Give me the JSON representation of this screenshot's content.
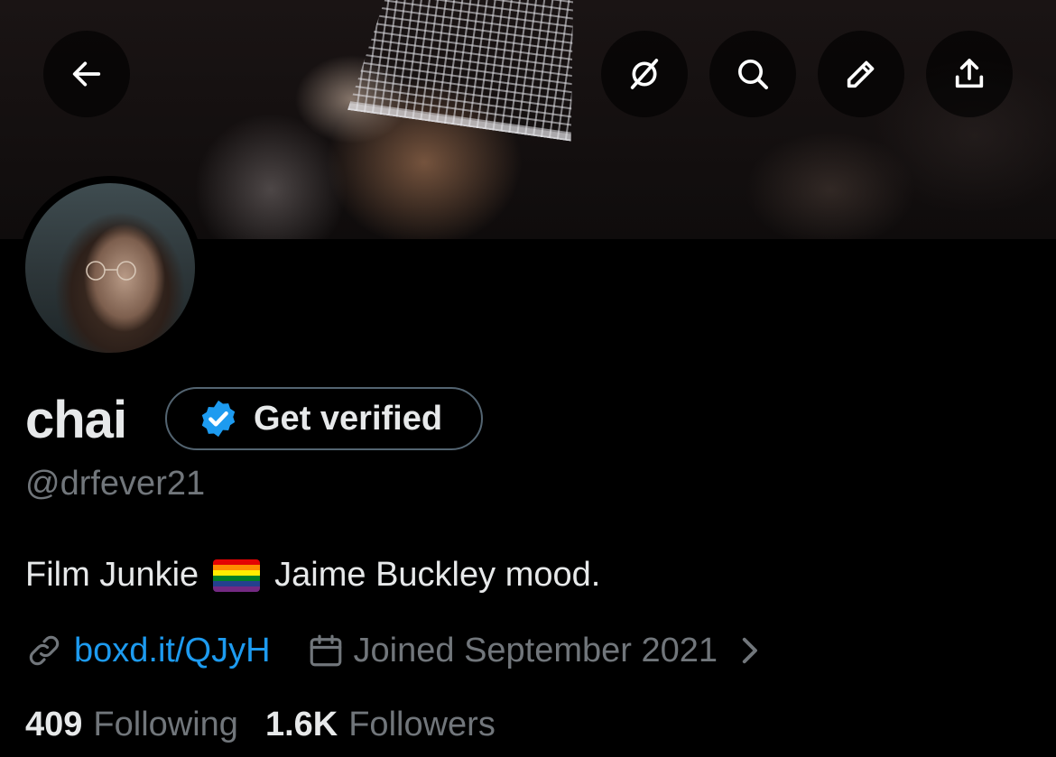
{
  "header": {
    "back_icon": "arrow-left-icon",
    "actions": [
      {
        "icon": "grok-icon"
      },
      {
        "icon": "search-icon"
      },
      {
        "icon": "pencil-icon"
      },
      {
        "icon": "share-icon"
      }
    ]
  },
  "profile": {
    "display_name": "chai",
    "verify_label": "Get verified",
    "handle": "@drfever21",
    "bio_before": "Film Junkie",
    "bio_emoji": "rainbow-flag",
    "bio_after": "Jaime Buckley mood.",
    "website": "boxd.it/QJyH",
    "joined": "Joined September 2021",
    "following_count": "409",
    "following_label": "Following",
    "followers_count": "1.6K",
    "followers_label": "Followers"
  },
  "colors": {
    "background": "#000000",
    "text": "#e7e9ea",
    "muted": "#71767b",
    "link": "#1d9bf0",
    "verified_badge": "#1d9bf0"
  }
}
